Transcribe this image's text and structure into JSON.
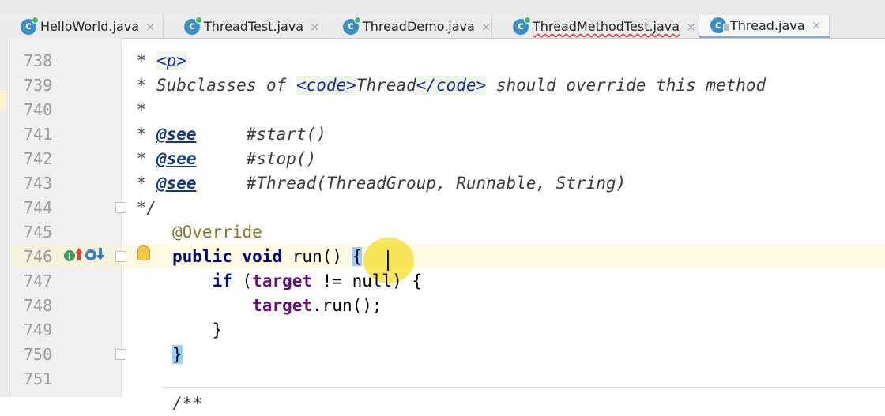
{
  "tabs": [
    {
      "label": "HelloWorld.java",
      "close": "×"
    },
    {
      "label": "ThreadTest.java",
      "close": "×"
    },
    {
      "label": "ThreadDemo.java",
      "close": "×"
    },
    {
      "label": "ThreadMethodTest.java",
      "close": "×"
    },
    {
      "label": "Thread.java",
      "close": "×"
    }
  ],
  "tab_icon_letter": "c",
  "gutter": {
    "line_numbers": [
      "738",
      "739",
      "740",
      "741",
      "742",
      "743",
      "744",
      "745",
      "746",
      "747",
      "748",
      "749",
      "750",
      "751"
    ],
    "icons": [
      "implement-icon",
      "override-up-arrow-icon",
      "overridden-icon",
      "down-arrow-icon",
      "lightbulb-icon"
    ]
  },
  "code": {
    "l738_star": " * ",
    "l738_p": "<p>",
    "l739_a": " * Subclasses of ",
    "l739_code1": "<code>",
    "l739_thread": "Thread",
    "l739_code2": "</code>",
    "l739_b": " should override this method",
    "l740": " *",
    "l741_star": " * ",
    "l741_see": "@see",
    "l741_ref": "     #start()",
    "l742_star": " * ",
    "l742_see": "@see",
    "l742_ref": "     #stop()",
    "l743_star": " * ",
    "l743_see": "@see",
    "l743_ref": "     #Thread(ThreadGroup, Runnable, String)",
    "l744": " */",
    "l745": "@Override",
    "l746_kw1": "public",
    "l746_kw2": "void",
    "l746_sig": " run() ",
    "l746_brace": "{",
    "l747_indent": "    ",
    "l747_if": "if",
    "l747_open": " (",
    "l747_target": "target",
    "l747_rest": " != null) {",
    "l748_indent": "        ",
    "l748_target": "target",
    "l748_rest": ".run();",
    "l749": "    }",
    "l750": "}",
    "l752": "/**"
  },
  "colors": {
    "keyword": "#000080",
    "field": "#660e7a",
    "annotation": "#7f7a2c",
    "brace_match": "#99ccff",
    "current_line": "#fdfbe1"
  }
}
